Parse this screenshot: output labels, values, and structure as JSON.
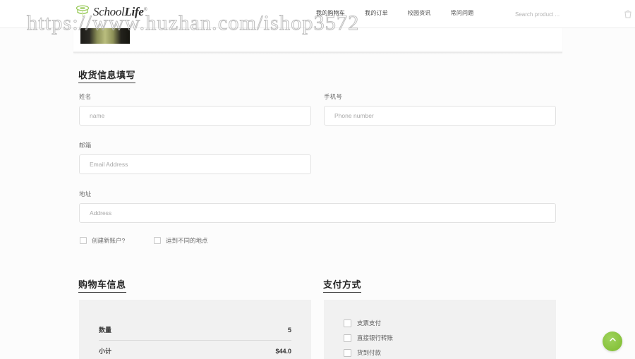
{
  "header": {
    "logo": {
      "icon": "graduation-cap-icon",
      "text_light": "School",
      "text_bold": "Life",
      "trademark": "®"
    },
    "nav": [
      {
        "label": "我的购物车"
      },
      {
        "label": "我的订单"
      },
      {
        "label": "校园资讯"
      },
      {
        "label": "常问问题"
      }
    ],
    "search": {
      "placeholder": "Search product ...",
      "value": "",
      "icon": "search-icon"
    },
    "cart_icon": "shopping-cart-icon"
  },
  "watermark": {
    "text": "https://www.huzhan.com/ishop3572"
  },
  "shipping": {
    "title": "收货信息填写",
    "fields": [
      {
        "label": "姓名",
        "placeholder": "name",
        "value": ""
      },
      {
        "label": "手机号",
        "placeholder": "Phone number",
        "value": ""
      },
      {
        "label": "邮箱",
        "placeholder": "Email Address",
        "value": ""
      },
      {
        "label": "地址",
        "placeholder": "Address",
        "value": ""
      }
    ],
    "checkboxes": [
      {
        "label": "创建新账户?",
        "checked": false
      },
      {
        "label": "运到不同的地点",
        "checked": false
      }
    ]
  },
  "cart": {
    "title": "购物车信息",
    "rows": [
      {
        "label": "数量",
        "value": "5"
      },
      {
        "label": "小计",
        "value": "$44.0"
      }
    ]
  },
  "payment": {
    "title": "支付方式",
    "options": [
      {
        "label": "支票支付",
        "checked": false
      },
      {
        "label": "直接银行转账",
        "checked": false
      },
      {
        "label": "货到付款",
        "checked": false
      }
    ]
  },
  "scroll_top": {
    "icon": "chevron-up-icon",
    "color": "#8cc63f"
  }
}
